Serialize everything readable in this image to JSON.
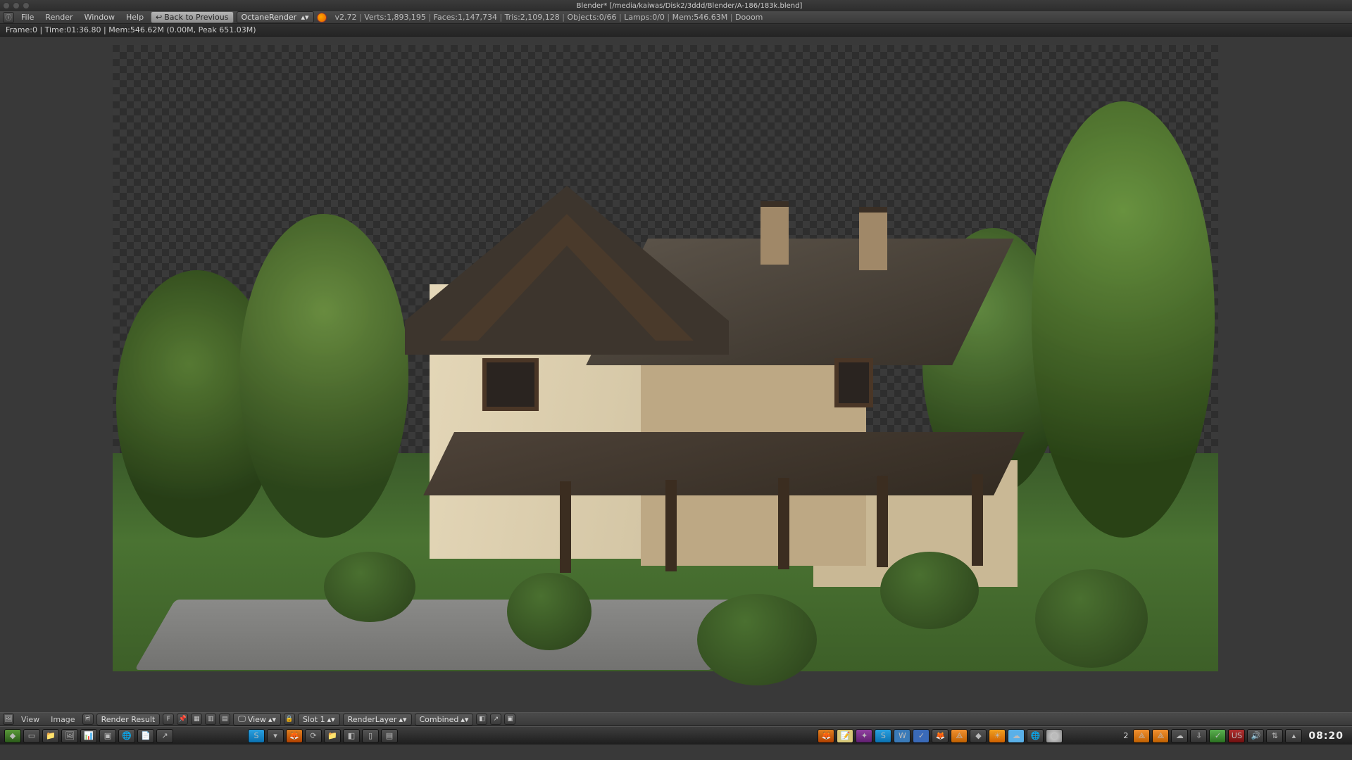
{
  "titlebar": {
    "title": "Blender* [/media/kaiwas/Disk2/3ddd/Blender/A-186/183k.blend]"
  },
  "menu": {
    "file": "File",
    "render": "Render",
    "window": "Window",
    "help": "Help"
  },
  "header": {
    "back_label": "Back to Previous",
    "engine": "OctaneRender",
    "version": "v2.72",
    "verts": "Verts:1,893,195",
    "faces": "Faces:1,147,734",
    "tris": "Tris:2,109,128",
    "objects": "Objects:0/66",
    "lamps": "Lamps:0/0",
    "mem": "Mem:546.63M",
    "scene": "Dooom"
  },
  "render_status": "Frame:0 | Time:01:36.80 | Mem:546.62M (0.00M, Peak 651.03M)",
  "image_bar": {
    "view": "View",
    "image": "Image",
    "result": "Render Result",
    "f": "F",
    "view_mode": "View",
    "slot": "Slot 1",
    "layer": "RenderLayer",
    "pass": "Combined"
  },
  "taskbar": {
    "workspace": "2",
    "clock": "08:20"
  }
}
